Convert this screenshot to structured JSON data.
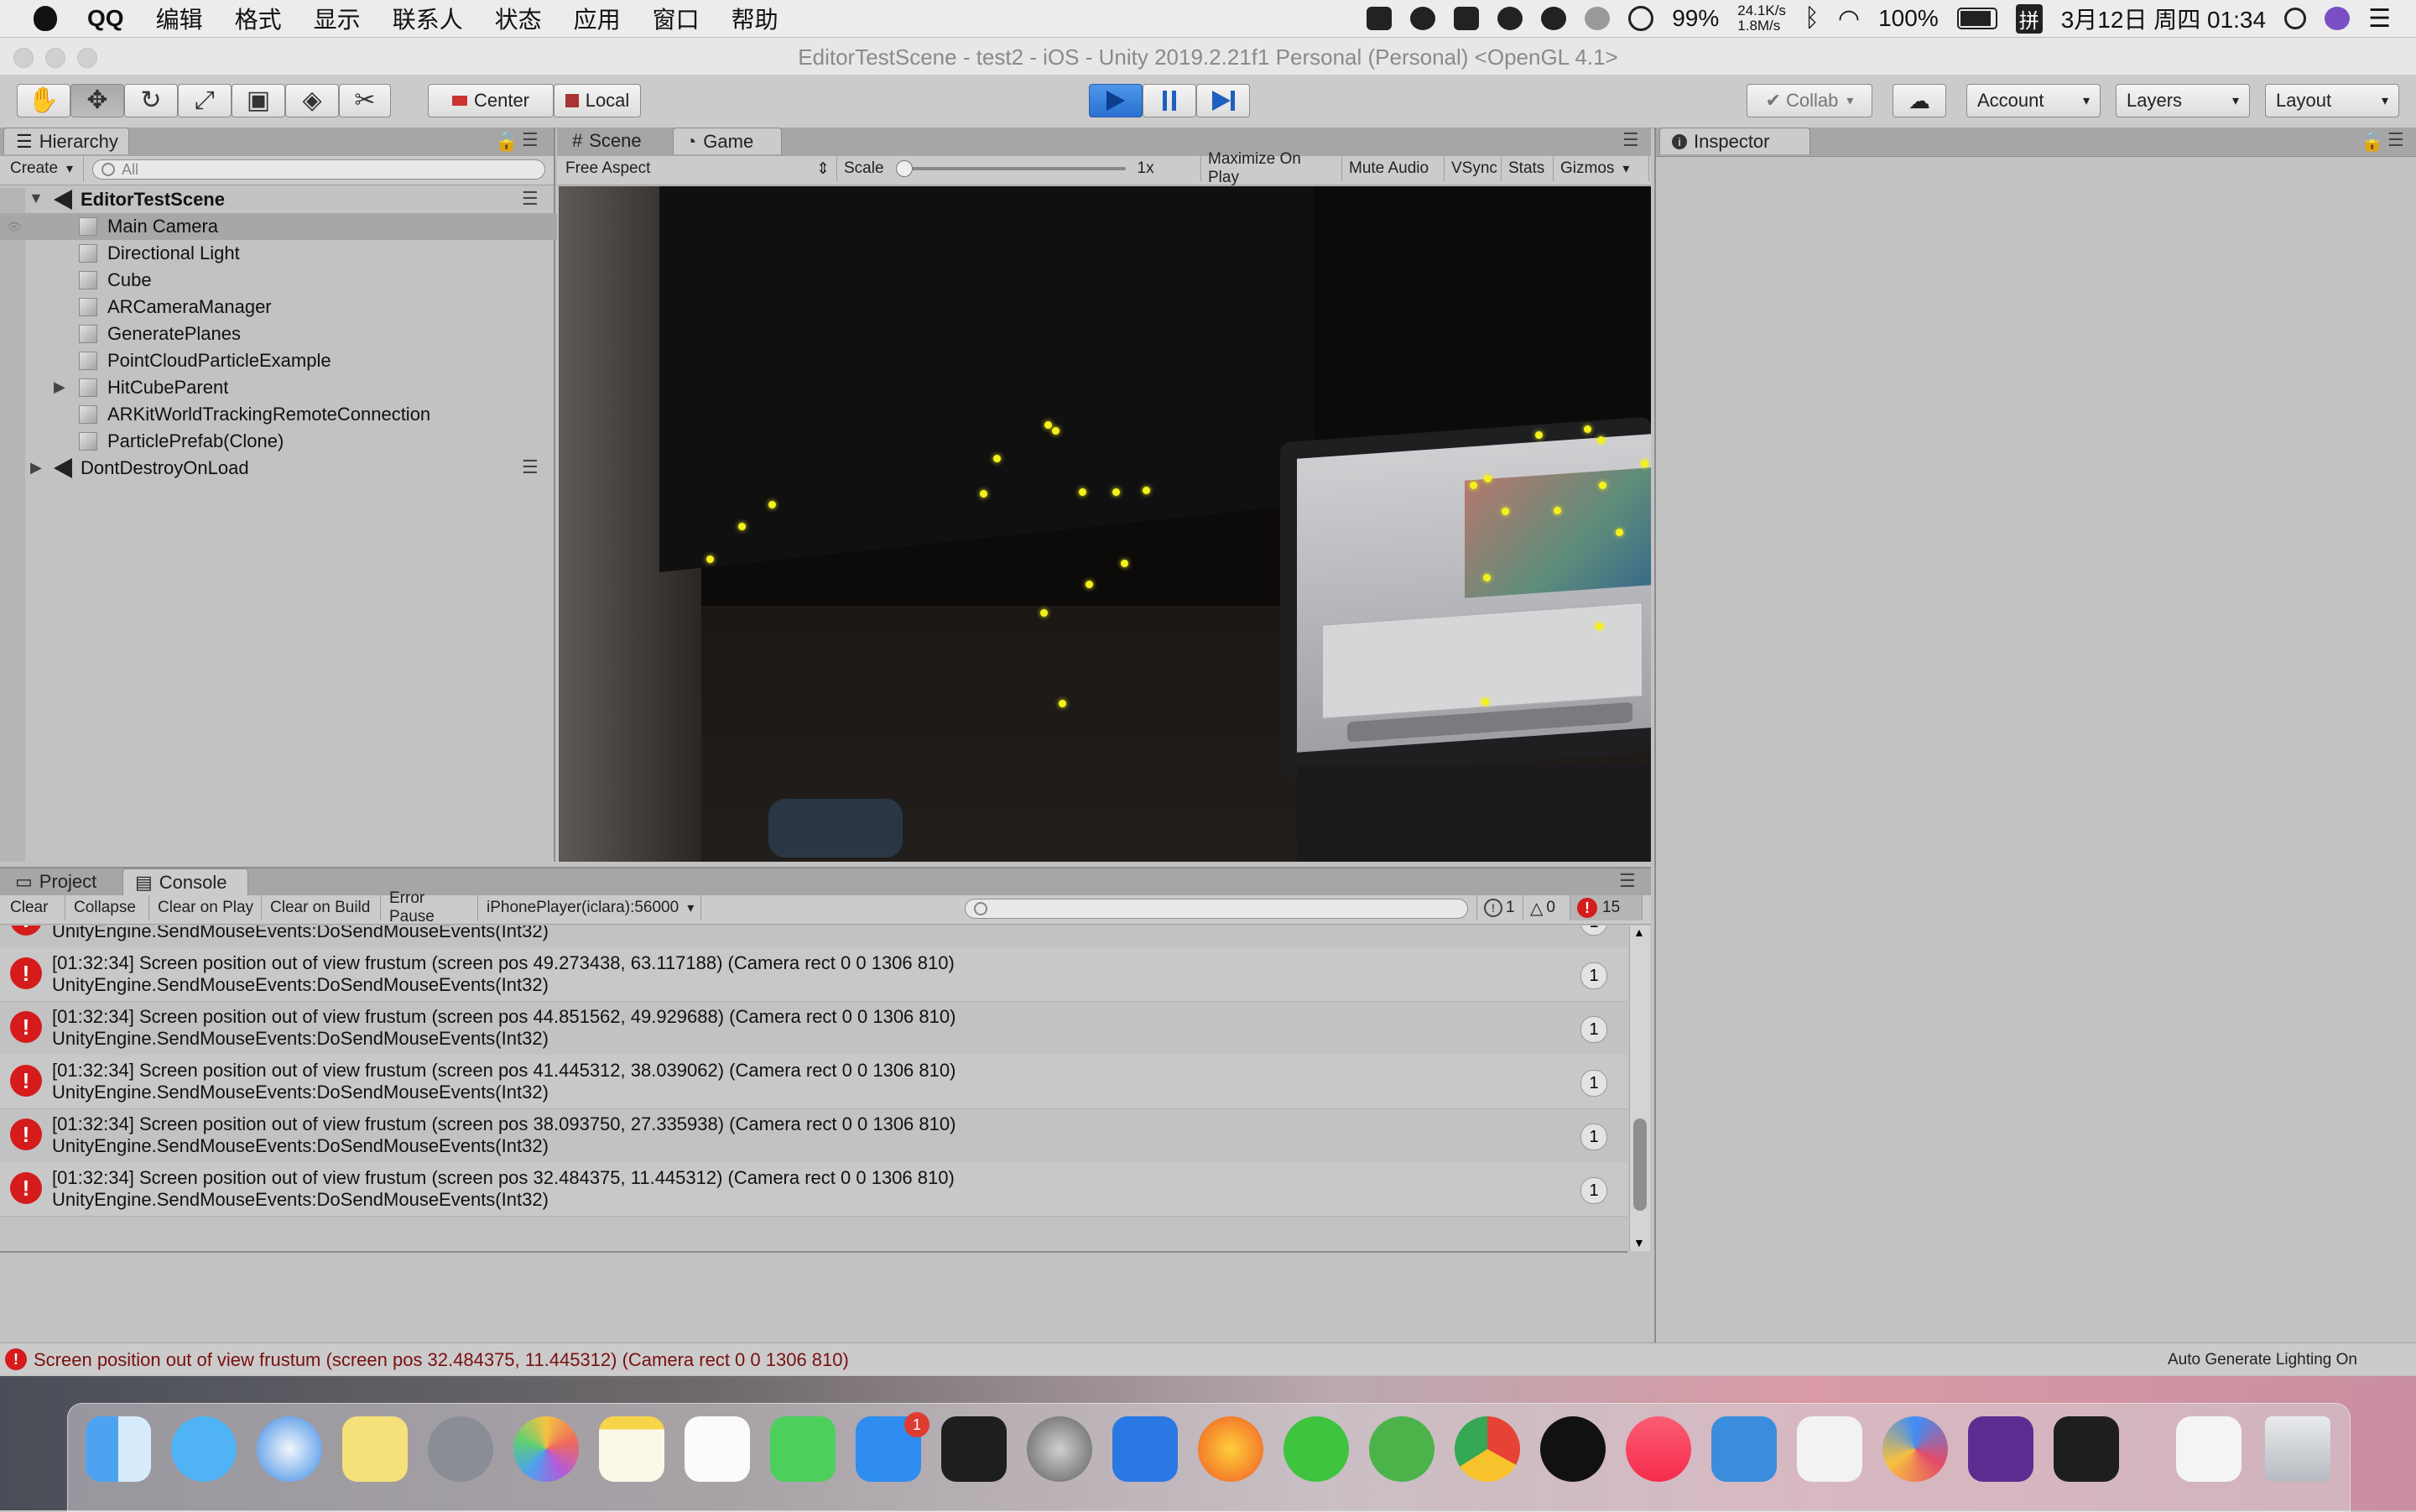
{
  "menubar": {
    "app": "QQ",
    "items": [
      "编辑",
      "格式",
      "显示",
      "联系人",
      "状态",
      "应用",
      "窗口",
      "帮助"
    ],
    "battery": "99%",
    "net_up": "24.1K/s",
    "net_down": "1.8M/s",
    "wifi_battery": "100%",
    "ime": "拼",
    "clock": "3月12日 周四 01:34"
  },
  "window": {
    "title": "EditorTestScene - test2 - iOS - Unity 2019.2.21f1 Personal (Personal) <OpenGL 4.1>"
  },
  "toolbar": {
    "tools": [
      "hand-tool",
      "move-tool",
      "rotate-tool",
      "scale-tool",
      "rect-tool",
      "transform-tool",
      "custom-tool"
    ],
    "pivot": "Center",
    "space": "Local",
    "collab": "Collab",
    "account": "Account",
    "layers": "Layers",
    "layout": "Layout"
  },
  "hierarchy": {
    "tab": "Hierarchy",
    "create": "Create",
    "search_placeholder": "All",
    "scene": "EditorTestScene",
    "items": [
      "Main Camera",
      "Directional Light",
      "Cube",
      "ARCameraManager",
      "GeneratePlanes",
      "PointCloudParticleExample",
      "HitCubeParent",
      "ARKitWorldTrackingRemoteConnection",
      "ParticlePrefab(Clone)"
    ],
    "selected": "Main Camera",
    "dontdestroy": "DontDestroyOnLoad"
  },
  "game": {
    "tab_scene": "Scene",
    "tab_game": "Game",
    "aspect": "Free Aspect",
    "scale_label": "Scale",
    "scale_value": "1x",
    "scale_fraction": 0,
    "buttons": [
      "Maximize On Play",
      "Mute Audio",
      "VSync",
      "Stats",
      "Gizmos"
    ]
  },
  "inspector": {
    "tab": "Inspector"
  },
  "console": {
    "tab_project": "Project",
    "tab_console": "Console",
    "buttons": [
      "Clear",
      "Collapse",
      "Clear on Play",
      "Clear on Build",
      "Error Pause"
    ],
    "player": "iPhonePlayer(iclara):56000",
    "counts": {
      "log": "1",
      "warn": "0",
      "error": "15"
    },
    "top_partial": "UnityEngine.SendMouseEvents:DoSendMouseEvents(Int32)",
    "rows": [
      {
        "line1": "[01:32:34] Screen position out of view frustum (screen pos 49.273438, 63.117188) (Camera rect 0 0 1306 810)",
        "line2": "UnityEngine.SendMouseEvents:DoSendMouseEvents(Int32)",
        "count": "1"
      },
      {
        "line1": "[01:32:34] Screen position out of view frustum (screen pos 44.851562, 49.929688) (Camera rect 0 0 1306 810)",
        "line2": "UnityEngine.SendMouseEvents:DoSendMouseEvents(Int32)",
        "count": "1"
      },
      {
        "line1": "[01:32:34] Screen position out of view frustum (screen pos 41.445312, 38.039062) (Camera rect 0 0 1306 810)",
        "line2": "UnityEngine.SendMouseEvents:DoSendMouseEvents(Int32)",
        "count": "1"
      },
      {
        "line1": "[01:32:34] Screen position out of view frustum (screen pos 38.093750, 27.335938) (Camera rect 0 0 1306 810)",
        "line2": "UnityEngine.SendMouseEvents:DoSendMouseEvents(Int32)",
        "count": "1"
      },
      {
        "line1": "[01:32:34] Screen position out of view frustum (screen pos 32.484375, 11.445312) (Camera rect 0 0 1306 810)",
        "line2": "UnityEngine.SendMouseEvents:DoSendMouseEvents(Int32)",
        "count": "1"
      }
    ]
  },
  "status": {
    "message": "Screen position out of view frustum (screen pos 32.484375, 11.445312) (Camera rect 0 0 1306 810)",
    "right": "Auto Generate Lighting On"
  },
  "dock": {
    "icons": [
      "finder-icon",
      "messages-icon",
      "safari-icon",
      "stickies-icon",
      "launchpad-icon",
      "photos-icon",
      "notes-icon",
      "reminders-icon",
      "facetime-icon",
      "app-store-icon",
      "terminal-icon",
      "system-preferences-icon",
      "wps-icon",
      "firefox-icon",
      "wechat-icon",
      "evernote-icon",
      "chrome-icon",
      "qq-icon",
      "music-icon",
      "xcode-icon",
      "unity-hub-icon",
      "baidu-netdisk-icon",
      "visual-studio-icon",
      "unity-icon",
      "unity-doc-icon",
      "trash-icon"
    ],
    "appstore_badge": "1"
  },
  "colors": {
    "accent": "#2a6fd0",
    "error": "#d51b1b",
    "panel": "#c2c2c2"
  }
}
